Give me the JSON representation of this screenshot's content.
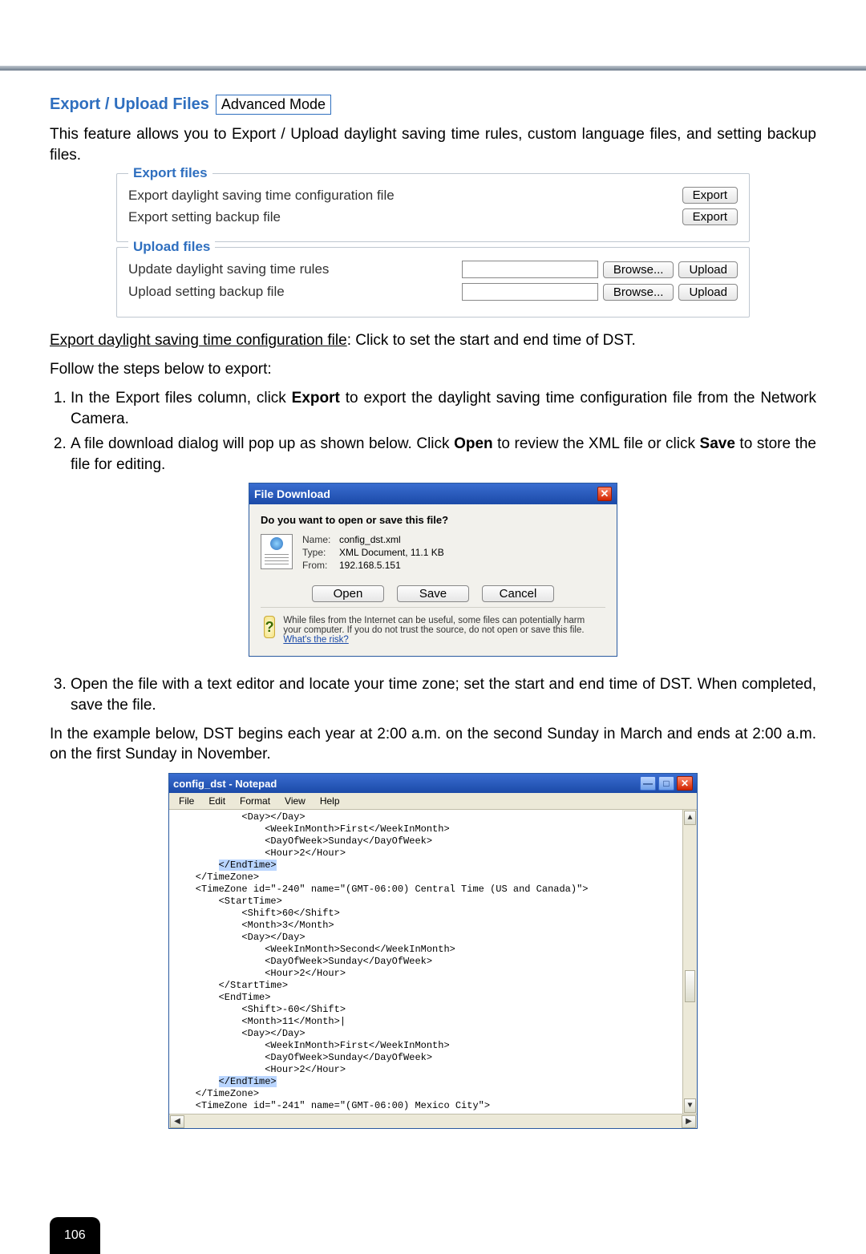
{
  "page_number": "106",
  "section": {
    "title": "Export / Upload Files",
    "mode_badge": "Advanced Mode"
  },
  "intro_para": "This feature allows you to Export / Upload daylight saving time rules, custom language files, and setting backup files.",
  "export_panel": {
    "legend": "Export files",
    "row1_label": "Export daylight saving time configuration file",
    "row2_label": "Export setting backup file",
    "export_btn": "Export"
  },
  "upload_panel": {
    "legend": "Upload files",
    "row1_label": "Update daylight saving time rules",
    "row2_label": "Upload setting backup file",
    "browse_btn": "Browse...",
    "upload_btn": "Upload"
  },
  "inst1": {
    "label_ul": "Export daylight saving time configuration file",
    "tail": ": Click to set the start and end time of DST."
  },
  "follow": "Follow the steps below to export:",
  "steps": {
    "s1_a": "In the Export files column, click ",
    "s1_b": "Export",
    "s1_c": " to export the daylight saving time configuration file from the Network Camera.",
    "s2_a": "A file download dialog will pop up as shown below. Click ",
    "s2_b": "Open",
    "s2_c": " to review the XML file or click ",
    "s2_d": "Save",
    "s2_e": " to store the file for editing.",
    "s3": "Open the file with a text editor and locate your time zone; set the start and end time of DST.  When completed, save the file.",
    "s3_para": "In the example below, DST begins each year at 2:00 a.m. on the second Sunday in March and ends at 2:00 a.m. on the first Sunday in November."
  },
  "file_download": {
    "title": "File Download",
    "question": "Do you want to open or save this file?",
    "kv": {
      "name_k": "Name:",
      "name_v": "config_dst.xml",
      "type_k": "Type:",
      "type_v": "XML Document, 11.1 KB",
      "from_k": "From:",
      "from_v": "192.168.5.151"
    },
    "actions": {
      "open": "Open",
      "save": "Save",
      "cancel": "Cancel"
    },
    "warn_text": "While files from the Internet can be useful, some files can potentially harm your computer. If you do not trust the source, do not open or save this file. ",
    "warn_link": "What's the risk?"
  },
  "notepad": {
    "title": "config_dst - Notepad",
    "menu": [
      "File",
      "Edit",
      "Format",
      "View",
      "Help"
    ],
    "lines": [
      "            <Day></Day>",
      "                <WeekInMonth>First</WeekInMonth>",
      "                <DayOfWeek>Sunday</DayOfWeek>",
      "                <Hour>2</Hour>",
      "        </EndTime>",
      "    </TimeZone>",
      "    <TimeZone id=\"-240\" name=\"(GMT-06:00) Central Time (US and Canada)\">",
      "        <StartTime>",
      "            <Shift>60</Shift>",
      "            <Month>3</Month>",
      "            <Day></Day>",
      "                <WeekInMonth>Second</WeekInMonth>",
      "                <DayOfWeek>Sunday</DayOfWeek>",
      "                <Hour>2</Hour>",
      "        </StartTime>",
      "        <EndTime>",
      "            <Shift>-60</Shift>",
      "            <Month>11</Month>|",
      "            <Day></Day>",
      "                <WeekInMonth>First</WeekInMonth>",
      "                <DayOfWeek>Sunday</DayOfWeek>",
      "                <Hour>2</Hour>",
      "        </EndTime>",
      "    </TimeZone>",
      "    <TimeZone id=\"-241\" name=\"(GMT-06:00) Mexico City\">"
    ],
    "hl_line_a": 4,
    "hl_line_b": 22
  }
}
